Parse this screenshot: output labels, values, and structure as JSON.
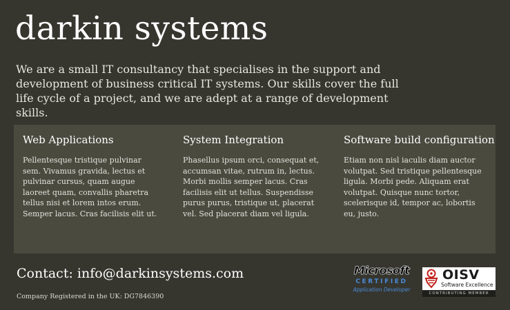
{
  "brand": {
    "name": "darkin systems"
  },
  "intro": {
    "text": "We are a small IT consultancy that specialises in the support and development of business critical IT systems.  Our skills cover the full life cycle of a project, and we are adept at a range of development skills."
  },
  "services": [
    {
      "title": "Web Applications",
      "body": "Pellentesque tristique pulvinar sem. Vivamus gravida, lectus et pulvinar cursus, quam augue laoreet quam, convallis pharetra tellus nisi et lorem intos erum. Semper lacus. Cras facilisis elit ut."
    },
    {
      "title": "System Integration",
      "body": "Phasellus ipsum orci, consequat et, accumsan vitae, rutrum in, lectus. Morbi mollis semper lacus. Cras facilisis elit ut tellus. Suspendisse purus purus, tristique ut, placerat vel. Sed placerat diam vel ligula."
    },
    {
      "title": "Software build configuration",
      "body": "Etiam non nisl iaculis diam auctor volutpat. Sed tristique pellentesque ligula. Morbi pede. Aliquam erat volutpat. Quisque nunc tortor, scelerisque id, tempor ac, lobortis eu, justo."
    }
  ],
  "footer": {
    "contact": "Contact: info@darkinsystems.com",
    "registration": "Company Registered in the UK: DG7846390"
  },
  "badges": {
    "microsoft": {
      "logo": "Microsoft",
      "certified": "CERTIFIED",
      "role": "Application Developer"
    },
    "oisv": {
      "name": "OISV",
      "tagline": "Software Excellence",
      "member": "CONTRIBUTING MEMBER",
      "emblem_icon": "oisv-emblem-icon"
    }
  },
  "colors": {
    "background": "#36362f",
    "panel": "#4a4a3f",
    "ms_blue": "#4a8ad8",
    "oisv_red": "#c0201a"
  }
}
